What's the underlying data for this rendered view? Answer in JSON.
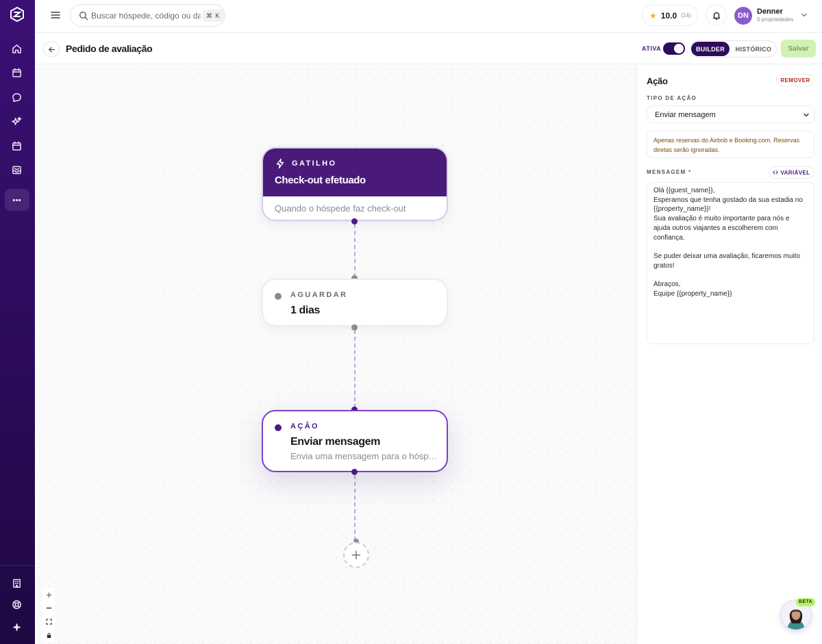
{
  "sidebar": {
    "logo": "brand-logo",
    "icons": [
      "home-icon",
      "calendar-icon",
      "chat-icon",
      "sparkles-icon",
      "calendar-alt-icon",
      "inbox-icon",
      "more-icon",
      "building-icon",
      "help-icon",
      "star-icon"
    ]
  },
  "topbar": {
    "search_placeholder": "Buscar hóspede, código ou data",
    "search_shortcut": "⌘ K",
    "rating_score": "10.0",
    "rating_count": "(14)",
    "user_initials": "DN",
    "user_name": "Denner",
    "user_sub": "5 propriedades"
  },
  "header": {
    "title": "Pedido de avaliação",
    "active_label": "ATIVA",
    "active": true,
    "tab_builder": "BUILDER",
    "tab_history": "HISTÓRICO",
    "save_label": "Salvar"
  },
  "flow": {
    "trigger": {
      "kicker": "GATILHO",
      "title": "Check-out efetuado",
      "desc": "Quando o hóspede faz check-out"
    },
    "wait": {
      "kicker": "AGUARDAR",
      "title": "1 dias"
    },
    "action": {
      "kicker": "AÇÃO",
      "title": "Enviar mensagem",
      "desc": "Envia uma mensagem para o hóspede"
    },
    "add_label": "+"
  },
  "panel": {
    "title": "Ação",
    "remove_label": "REMOVER",
    "action_type_label": "TIPO DE AÇÃO",
    "action_type_value": "Enviar mensagem",
    "notice": "Apenas reservas do Airbnb e Booking.com. Reservas diretas serão ignoradas.",
    "message_label": "MENSAGEM",
    "required_mark": "*",
    "variable_label": "VARIÁVEL",
    "message": "Olá {{guest_name}},\nEsperamos que tenha gostado da sua estadia no {{property_name}}!\nSua avaliação é muito importante para nós e ajuda outros viajantes a escolherem com confiança.\n\nSe puder deixar uma avaliação, ficaremos muito gratos!\n\nAbraços,\nEquipe {{property_name}}"
  },
  "beta_tag": "BETA",
  "colors": {
    "brand": "#2d0c5c",
    "trigger_header": "#4a1a7a",
    "action_border": "#7b3fc4",
    "save_bg": "#d1f2b5"
  }
}
